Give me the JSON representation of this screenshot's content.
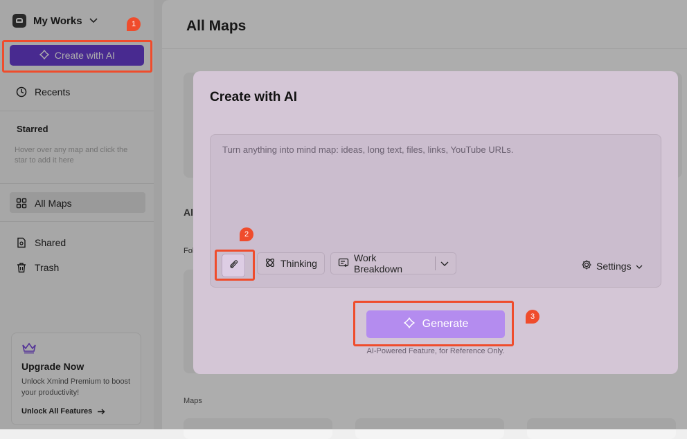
{
  "sidebar": {
    "workspace_title": "My Works",
    "create_ai_label": "Create with AI",
    "recents_label": "Recents",
    "starred_heading": "Starred",
    "starred_hint": "Hover over any map and click the star to add it here",
    "all_maps_label": "All Maps",
    "shared_label": "Shared",
    "trash_label": "Trash",
    "upgrade": {
      "title": "Upgrade Now",
      "description": "Unlock Xmind Premium to boost your productivity!",
      "link_label": "Unlock All Features"
    }
  },
  "main": {
    "title": "All Maps",
    "partial_heading": "Al",
    "partial_label": "Fol",
    "maps_label": "Maps"
  },
  "modal": {
    "title": "Create with AI",
    "prompt_placeholder": "Turn anything into mind map: ideas, long text, files, links, YouTube URLs.",
    "prompt_value": "",
    "thinking_label": "Thinking",
    "mode_label": "Work Breakdown",
    "settings_label": "Settings",
    "generate_label": "Generate",
    "disclaimer": "AI-Powered Feature, for Reference Only."
  },
  "annotations": {
    "badge_1": "1",
    "badge_2": "2",
    "badge_3": "3",
    "highlight_color": "#ef4c2c"
  },
  "colors": {
    "accent": "#6a3fd4",
    "generate_button": "#b48cef"
  },
  "icons": {
    "workspace": "workspace-icon",
    "ai_sparkle": "ai-sparkle-icon",
    "recents": "clock-icon",
    "all_maps": "grid-icon",
    "shared": "shared-doc-icon",
    "trash": "trash-icon",
    "crown": "crown-icon",
    "attach": "paperclip-icon",
    "thinking": "atom-icon",
    "mode": "work-breakdown-icon",
    "settings": "gear-icon"
  }
}
